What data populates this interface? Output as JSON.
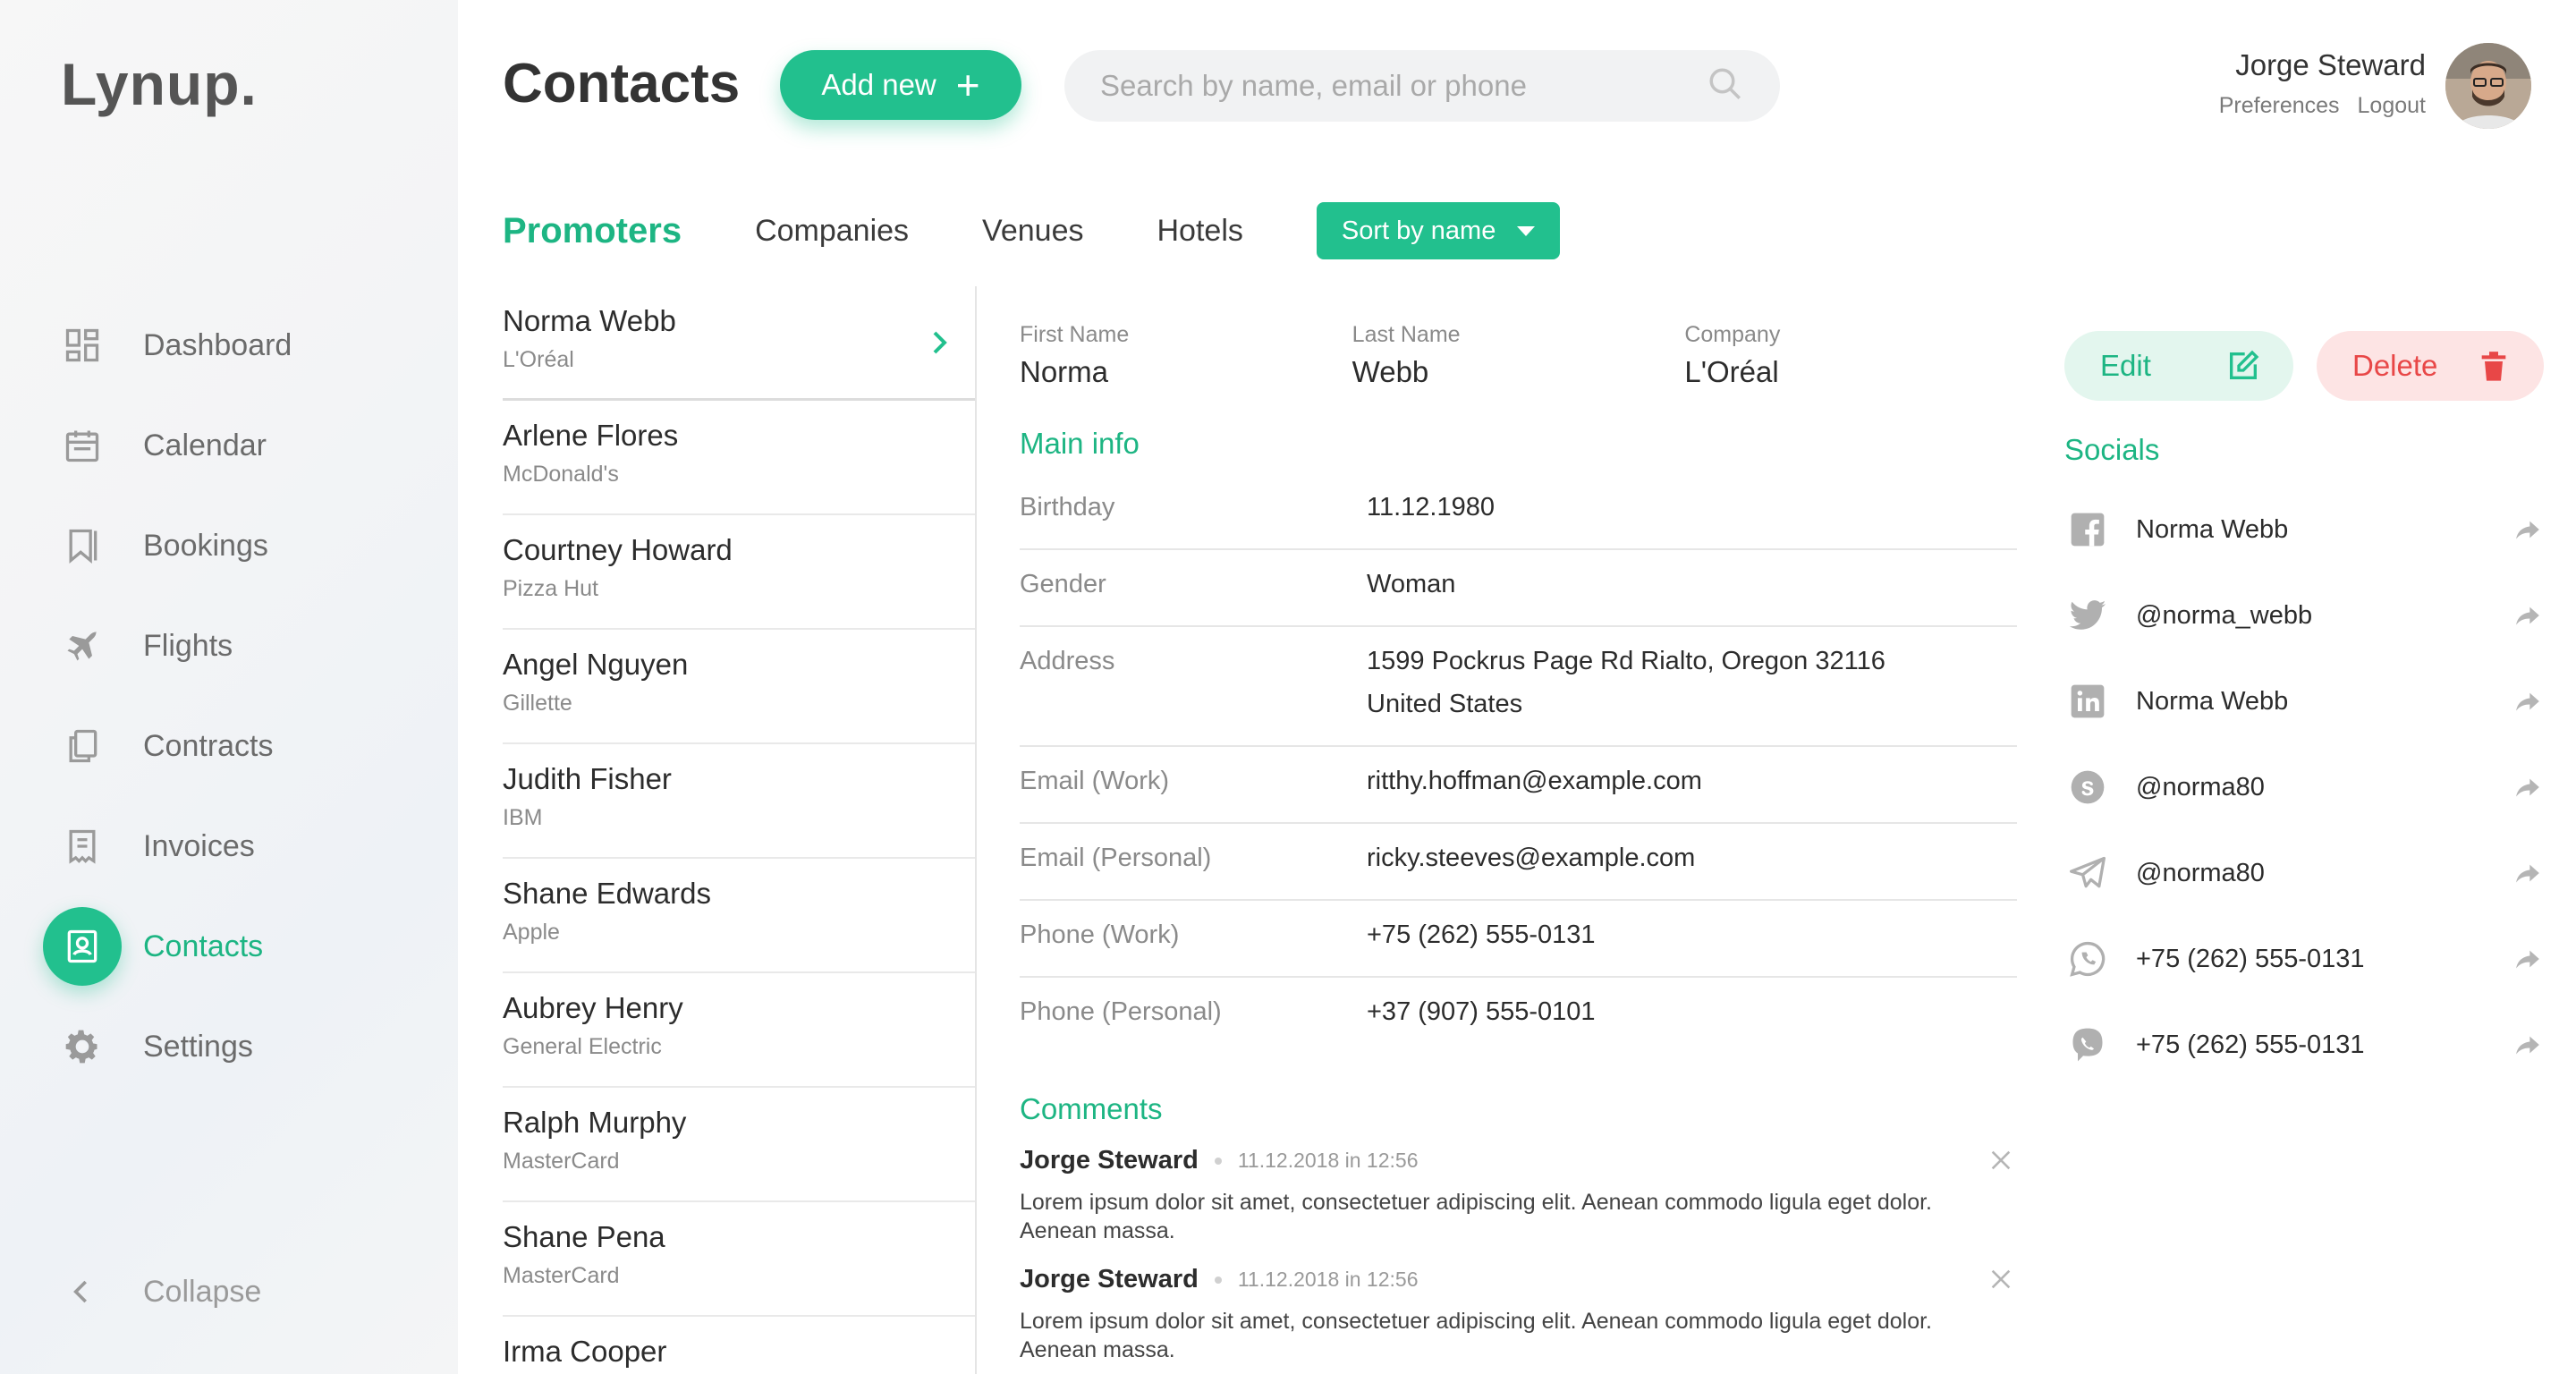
{
  "app": {
    "logo": "Lynup."
  },
  "sidebar": {
    "items": [
      {
        "label": "Dashboard",
        "icon": "dashboard-icon"
      },
      {
        "label": "Calendar",
        "icon": "calendar-icon"
      },
      {
        "label": "Bookings",
        "icon": "bookmark-icon"
      },
      {
        "label": "Flights",
        "icon": "plane-icon"
      },
      {
        "label": "Contracts",
        "icon": "documents-icon"
      },
      {
        "label": "Invoices",
        "icon": "invoice-icon"
      },
      {
        "label": "Contacts",
        "icon": "contact-card-icon",
        "active": true
      },
      {
        "label": "Settings",
        "icon": "gear-icon"
      }
    ],
    "collapse_label": "Collapse"
  },
  "header": {
    "title": "Contacts",
    "add_label": "Add new",
    "search_placeholder": "Search by name, email or phone"
  },
  "user": {
    "name": "Jorge Steward",
    "preferences": "Preferences",
    "logout": "Logout"
  },
  "tabs": {
    "items": [
      "Promoters",
      "Companies",
      "Venues",
      "Hotels"
    ],
    "active": "Promoters",
    "sort_label": "Sort by name"
  },
  "contacts": [
    {
      "name": "Norma Webb",
      "company": "L'Oréal"
    },
    {
      "name": "Arlene Flores",
      "company": "McDonald's"
    },
    {
      "name": "Courtney Howard",
      "company": "Pizza Hut"
    },
    {
      "name": "Angel Nguyen",
      "company": "Gillette"
    },
    {
      "name": "Judith Fisher",
      "company": "IBM"
    },
    {
      "name": "Shane Edwards",
      "company": "Apple"
    },
    {
      "name": "Aubrey Henry",
      "company": "General Electric"
    },
    {
      "name": "Ralph Murphy",
      "company": "MasterCard"
    },
    {
      "name": "Shane Pena",
      "company": "MasterCard"
    },
    {
      "name": "Irma Cooper",
      "company": ""
    }
  ],
  "detail": {
    "first_name_label": "First Name",
    "first_name": "Norma",
    "last_name_label": "Last Name",
    "last_name": "Webb",
    "company_label": "Company",
    "company": "L'Oréal",
    "main_info_title": "Main info",
    "fields": [
      {
        "key": "Birthday",
        "value": "11.12.1980"
      },
      {
        "key": "Gender",
        "value": "Woman"
      },
      {
        "key": "Address",
        "value": "1599 Pockrus Page Rd Rialto, Oregon 32116",
        "value2": "United States"
      },
      {
        "key": "Email (Work)",
        "value": "ritthy.hoffman@example.com"
      },
      {
        "key": "Email (Personal)",
        "value": "ricky.steeves@example.com"
      },
      {
        "key": "Phone (Work)",
        "value": "+75 (262) 555-0131"
      },
      {
        "key": "Phone (Personal)",
        "value": "+37 (907) 555-0101"
      }
    ],
    "comments_title": "Comments",
    "comments": [
      {
        "author": "Jorge Steward",
        "time": "11.12.2018 in 12:56",
        "text": "Lorem ipsum dolor sit amet, consectetuer adipiscing elit. Aenean commodo ligula eget dolor. Aenean massa."
      },
      {
        "author": "Jorge Steward",
        "time": "11.12.2018 in 12:56",
        "text": "Lorem ipsum dolor sit amet, consectetuer adipiscing elit. Aenean commodo ligula eget dolor. Aenean massa."
      }
    ]
  },
  "actions": {
    "edit_label": "Edit",
    "delete_label": "Delete"
  },
  "socials": {
    "title": "Socials",
    "items": [
      {
        "icon": "facebook-icon",
        "text": "Norma Webb"
      },
      {
        "icon": "twitter-icon",
        "text": "@norma_webb"
      },
      {
        "icon": "linkedin-icon",
        "text": "Norma Webb"
      },
      {
        "icon": "skype-icon",
        "text": "@norma80"
      },
      {
        "icon": "telegram-icon",
        "text": "@norma80"
      },
      {
        "icon": "whatsapp-icon",
        "text": "+75 (262) 555-0131"
      },
      {
        "icon": "viber-icon",
        "text": "+75 (262) 555-0131"
      }
    ]
  },
  "colors": {
    "accent": "#22c08e",
    "danger": "#e84747",
    "text": "#2c2c2c",
    "muted": "#8a8a8a"
  }
}
